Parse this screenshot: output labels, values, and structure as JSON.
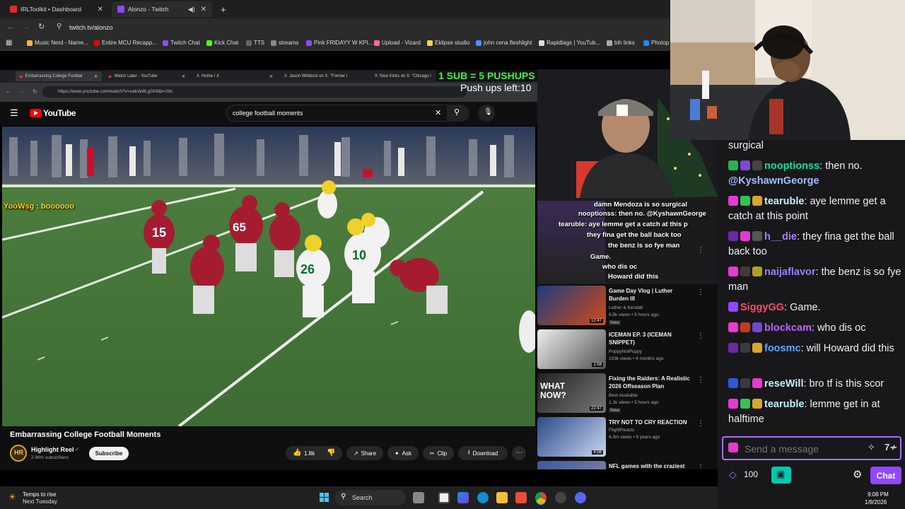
{
  "browser": {
    "tabs": [
      {
        "label": "IRLToolkit • Dashboard"
      },
      {
        "label": "Alonzo - Twitch"
      }
    ],
    "url": "twitch.tv/alonzo",
    "bookmarks": [
      "Music Nerd - Name...",
      "Entire MCU Recapp...",
      "Twitch Chat",
      "Kick Chat",
      "TTS",
      "streams",
      "Pink FRIDAYY W KPI...",
      "Upload - Vizard",
      "Eklipse studio",
      "john cena fleshlight",
      "Rapidtags | YouTub...",
      "bih links",
      "Photop"
    ]
  },
  "inner_browser": {
    "tabs": [
      "Embarrassing College Footbal",
      "Watch Later - YouTube",
      "Home / X",
      "Jason Whitlock on X: \"Former I",
      "Nice Kicks on X: \"Chicago I"
    ],
    "url": "https://www.youtube.com/watch?v=vakVe8Lg0X8&t=29s"
  },
  "overlay": {
    "sub_rule": "1 SUB = 5 PUSHUPS",
    "pushups_left": "Push ups left:10",
    "video_chat": "YooWsg : boooooo"
  },
  "youtube": {
    "logo": "YouTube",
    "search_query": "college football moments",
    "video_title": "Embarrassing College Football Moments",
    "channel": "Highlight Reel",
    "subscribers": "2.96m subscribers",
    "subscribe": "Subscribe",
    "likes": "1.8k",
    "share": "Share",
    "ask": "Ask",
    "clip": "Clip",
    "download": "Download"
  },
  "overlay_chat": [
    "damn Mendoza is so surgical",
    "nooptionss: then no. @KyshawnGeorge",
    "tearuble: aye lemme get a catch at this p",
    "they fina get the ball back too",
    "the benz is so fye man",
    "Game.",
    "who dis oc",
    "Howard did this"
  ],
  "recommendations": [
    {
      "title": "Game Day Vlog | Luther Burden III",
      "channel": "Luther & Kendall",
      "stats": "6.5k views • 9 hours ago",
      "badge": "New",
      "duration": "12:47"
    },
    {
      "title": "ICEMAN EP. 3 (ICEMAN SNIPPET)",
      "channel": "PoppyNotPuppy",
      "stats": "103k views • 4 months ago",
      "badge": "",
      "duration": "1:58"
    },
    {
      "title": "Fixing the Raiders: A Realistic 2026 Offseason Plan",
      "channel": "Best Available",
      "stats": "1.1k views • 5 hours ago",
      "badge": "New",
      "duration": "22:47"
    },
    {
      "title": "TRY NOT TO CRY REACTION",
      "channel": "FlightReacts",
      "stats": "4.3m views • 9 years ago",
      "badge": "",
      "duration": "4:56"
    },
    {
      "title": "NFL games with the craziest",
      "channel": "",
      "stats": "",
      "badge": "",
      "duration": ""
    }
  ],
  "chat": {
    "messages": [
      {
        "user": "",
        "text": "surgical",
        "color": "#efeff1"
      },
      {
        "user": "nooptionss",
        "text": ": then no.",
        "mention": "@KyshawnGeorge",
        "color": "#00e6a0"
      },
      {
        "user": "tearuble",
        "text": ": aye lemme get a catch at this point",
        "color": "#c5f0ff"
      },
      {
        "user": "h__die",
        "text": ": they fina get the ball back too",
        "color": "#b07aff"
      },
      {
        "user": "naijaflavor",
        "text": ": the benz is so fye man",
        "color": "#9d7dff"
      },
      {
        "user": "SiggyGG",
        "text": ": Game.",
        "color": "#ff4a6b"
      },
      {
        "user": "blockcam",
        "text": ": who dis oc",
        "color": "#bd5cff"
      },
      {
        "user": "foosmc",
        "text": ": will Howard did this",
        "color": "#5ca7ff"
      },
      {
        "user": "reseWill",
        "text": ": bro tf is this scor",
        "color": "#c5f0ff"
      },
      {
        "user": "tearuble",
        "text": ": lemme get in at halftime",
        "color": "#c5f0ff"
      }
    ],
    "input_placeholder": "Send a message",
    "points": "100",
    "chat_button": "Chat"
  },
  "taskbar": {
    "weather_line1": "Temps to rise",
    "weather_line2": "Next Tuesday",
    "search": "Search",
    "time": "9:08 PM",
    "date": "1/9/2026"
  },
  "colors": {
    "twitch_purple": "#9147ff",
    "sub_green": "#3df53d",
    "field_green": "#4a7a3c"
  }
}
